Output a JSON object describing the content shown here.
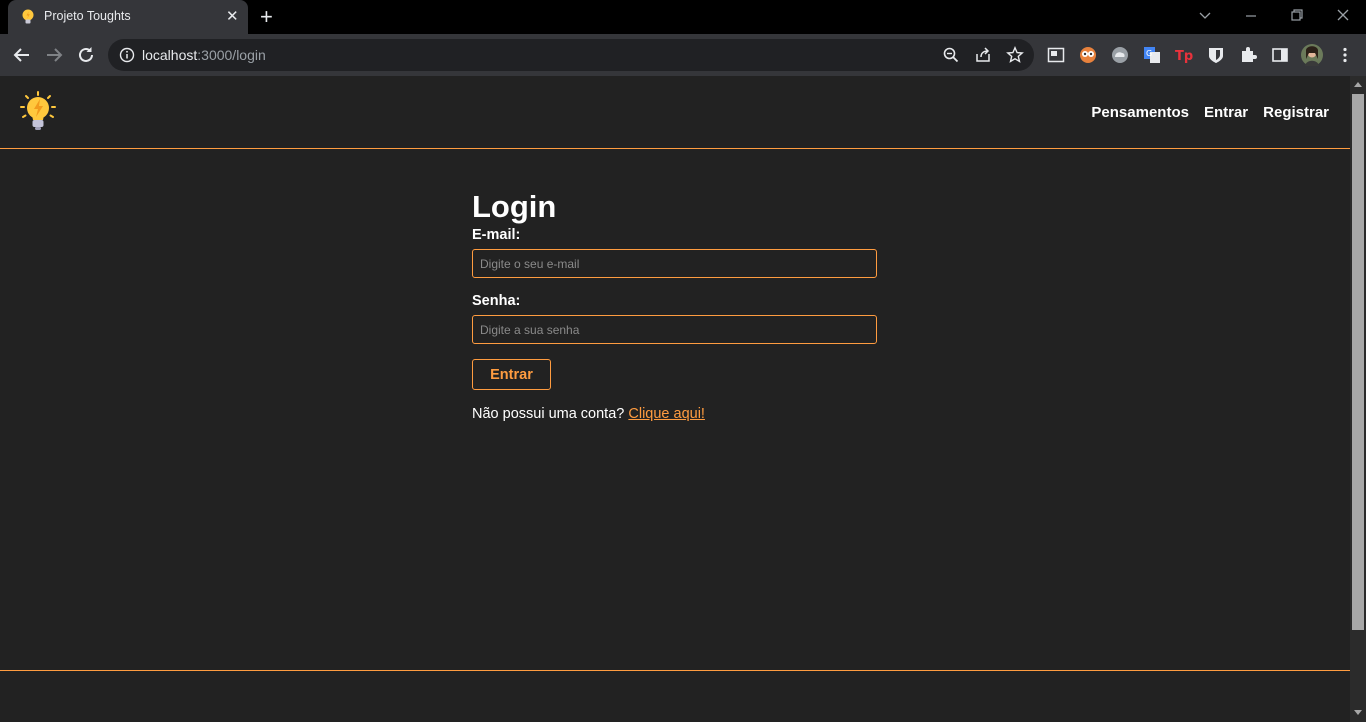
{
  "browser": {
    "tab_title": "Projeto Toughts",
    "tab_close": "✕",
    "new_tab": "+",
    "url_host": "localhost",
    "url_rest": ":3000/login"
  },
  "navbar": {
    "links": [
      "Pensamentos",
      "Entrar",
      "Registrar"
    ]
  },
  "login": {
    "title": "Login",
    "email_label": "E-mail:",
    "email_placeholder": "Digite o seu e-mail",
    "email_value": "",
    "password_label": "Senha:",
    "password_placeholder": "Digite a sua senha",
    "password_value": "",
    "submit_label": "Entrar",
    "signup_text": "Não possui uma conta?",
    "signup_link": "Clique aqui!"
  },
  "colors": {
    "accent": "#ff9c40",
    "background": "#222222",
    "text": "#ffffff"
  },
  "icons": [
    "lightbulb-icon",
    "back-icon",
    "forward-icon",
    "reload-icon",
    "info-icon",
    "zoom-icon",
    "share-icon",
    "star-icon",
    "extensions-icon",
    "sidepanel-icon",
    "profile-avatar",
    "menu-icon"
  ]
}
